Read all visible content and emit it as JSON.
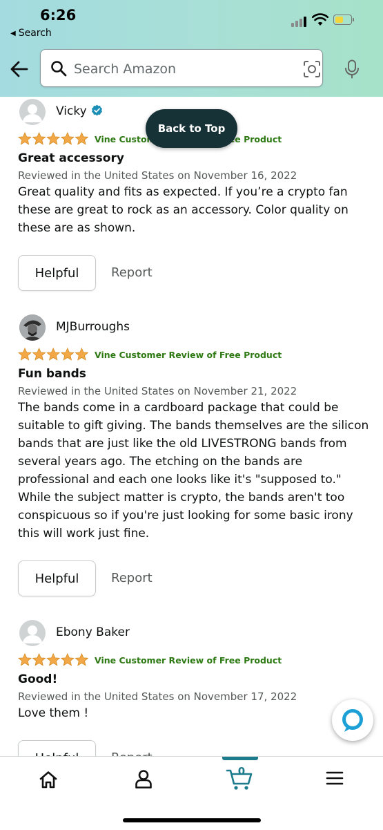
{
  "status_bar": {
    "time": "6:26",
    "back_label": "Search"
  },
  "search": {
    "placeholder": "Search Amazon"
  },
  "back_to_top_label": "Back to Top",
  "reviews": [
    {
      "name": "Vicky",
      "verified": true,
      "stars": 5,
      "vine_label": "Vine Customer Review of Free Product",
      "title": "Great accessory",
      "meta": "Reviewed in the United States on November 16, 2022",
      "body": "Great quality and fits as expected. If you’re a crypto fan these are great to rock as an accessory. Color quality on these are as shown.",
      "helpful_label": "Helpful",
      "report_label": "Report"
    },
    {
      "name": "MJBurroughs",
      "verified": false,
      "stars": 5,
      "vine_label": "Vine Customer Review of Free Product",
      "title": "Fun bands",
      "meta": "Reviewed in the United States on November 21, 2022",
      "body": "The bands come in a cardboard package that could be suitable to gift giving. The bands themselves are the silicon bands that are just like the old LIVESTRONG bands from several years ago. The etching on the bands are professional and each one looks like it's \"supposed to.\" While the subject matter is crypto, the bands aren't too conspicuous so if you're just looking for some basic irony this will work just fine.",
      "helpful_label": "Helpful",
      "report_label": "Report"
    },
    {
      "name": "Ebony Baker",
      "verified": false,
      "stars": 5,
      "vine_label": "Vine Customer Review of Free Product",
      "title": "Good!",
      "meta": "Reviewed in the United States on November 17, 2022",
      "body": "Love them !",
      "helpful_label": "Helpful",
      "report_label": "Report"
    }
  ],
  "bottom_nav": {
    "items": [
      "home-icon",
      "account-icon",
      "cart-icon",
      "menu-icon"
    ],
    "cart_count": "0"
  },
  "colors": {
    "header_gradient": [
      "#a3dbe0",
      "#a6e2c9"
    ],
    "star": "#f3a847",
    "vine_green": "#2d7a13",
    "back_to_top_bg": "#173236",
    "cart_accent": "#1d7c8c"
  }
}
